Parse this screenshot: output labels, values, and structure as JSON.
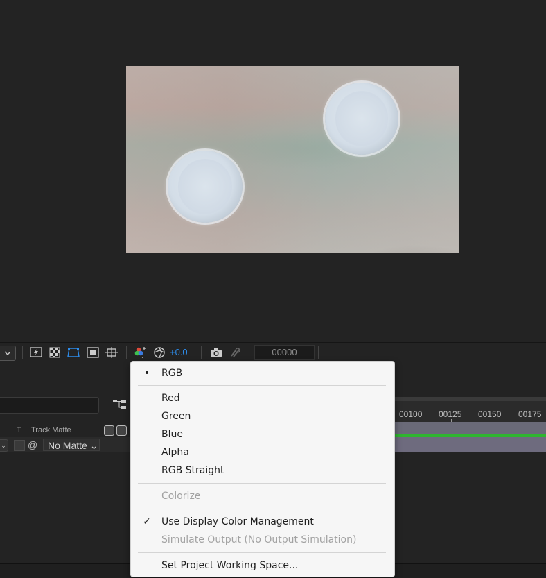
{
  "toolbar": {
    "exposure": "+0.0",
    "timecode": "00000"
  },
  "timeline": {
    "col_t": "T",
    "col_track_matte": "Track Matte",
    "matte_value": "No Matte",
    "ruler": [
      "00100",
      "00125",
      "00150",
      "00175"
    ]
  },
  "menu": {
    "rgb": "RGB",
    "red": "Red",
    "green": "Green",
    "blue": "Blue",
    "alpha": "Alpha",
    "rgb_straight": "RGB Straight",
    "colorize": "Colorize",
    "use_display_cm": "Use Display Color Management",
    "simulate_output": "Simulate Output (No Output Simulation)",
    "set_working_space": "Set Project Working Space...",
    "bullet": "•",
    "check": "✓"
  },
  "colors": {
    "accent": "#2d8ceb",
    "green_bar": "#2fb52f",
    "menu_bg": "#f6f6f6"
  }
}
